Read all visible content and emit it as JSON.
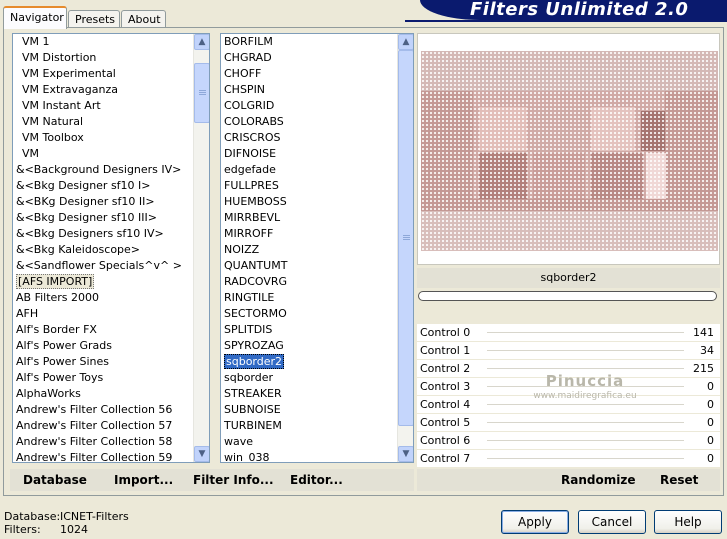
{
  "tabs": [
    "Navigator",
    "Presets",
    "About"
  ],
  "title": "Filters Unlimited 2.0",
  "categories": [
    "VM 1",
    "VM Distortion",
    "VM Experimental",
    "VM Extravaganza",
    "VM Instant Art",
    "VM Natural",
    "VM Toolbox",
    "VM",
    "&<Background Designers IV>",
    "&<Bkg Designer sf10 I>",
    "&<BKg Designer sf10 II>",
    "&<Bkg Designer sf10 III>",
    "&<Bkg Designers sf10 IV>",
    "&<Bkg Kaleidoscope>",
    "&<Sandflower Specials^v^ >",
    "[AFS IMPORT]",
    "AB Filters 2000",
    "AFH",
    "Alf's Border FX",
    "Alf's Power Grads",
    "Alf's Power Sines",
    "Alf's Power Toys",
    "AlphaWorks",
    "Andrew's Filter Collection 56",
    "Andrew's Filter Collection 57",
    "Andrew's Filter Collection 58",
    "Andrew's Filter Collection 59"
  ],
  "filters": [
    "BORFILM",
    "CHGRAD",
    "CHOFF",
    "CHSPIN",
    "COLGRID",
    "COLORABS",
    "CRISCROS",
    "DIFNOISE",
    "edgefade",
    "FULLPRES",
    "HUEMBOSS",
    "MIRRBEVL",
    "MIRROFF",
    "NOIZZ",
    "QUANTUMT",
    "RADCOVRG",
    "RINGTILE",
    "SECTORMO",
    "SPLITDIS",
    "SPYROZAG",
    "sqborder2",
    "sqborder",
    "STREAKER",
    "SUBNOISE",
    "TURBINEM",
    "wave",
    "win_038"
  ],
  "left_links": [
    "Database",
    "Import...",
    "Filter Info...",
    "Editor..."
  ],
  "right_links": [
    "Randomize",
    "Reset"
  ],
  "filter_name": "sqborder2",
  "controls": [
    {
      "label": "Control 0",
      "value": "141"
    },
    {
      "label": "Control 1",
      "value": "34"
    },
    {
      "label": "Control 2",
      "value": "215"
    },
    {
      "label": "Control 3",
      "value": "0"
    },
    {
      "label": "Control 4",
      "value": "0"
    },
    {
      "label": "Control 5",
      "value": "0"
    },
    {
      "label": "Control 6",
      "value": "0"
    },
    {
      "label": "Control 7",
      "value": "0"
    }
  ],
  "watermark": {
    "name": "Pinuccia",
    "site": "www.maidiregrafica.eu"
  },
  "footer": {
    "database_label": "Database:",
    "database_value": "ICNET-Filters",
    "filters_label": "Filters:",
    "filters_value": "1024"
  },
  "buttons": {
    "apply": "Apply",
    "cancel": "Cancel",
    "help": "Help"
  },
  "colors": {
    "selection": "#316ac5",
    "banner": "#0a1a6e",
    "preview_base": "#c8a29f"
  }
}
